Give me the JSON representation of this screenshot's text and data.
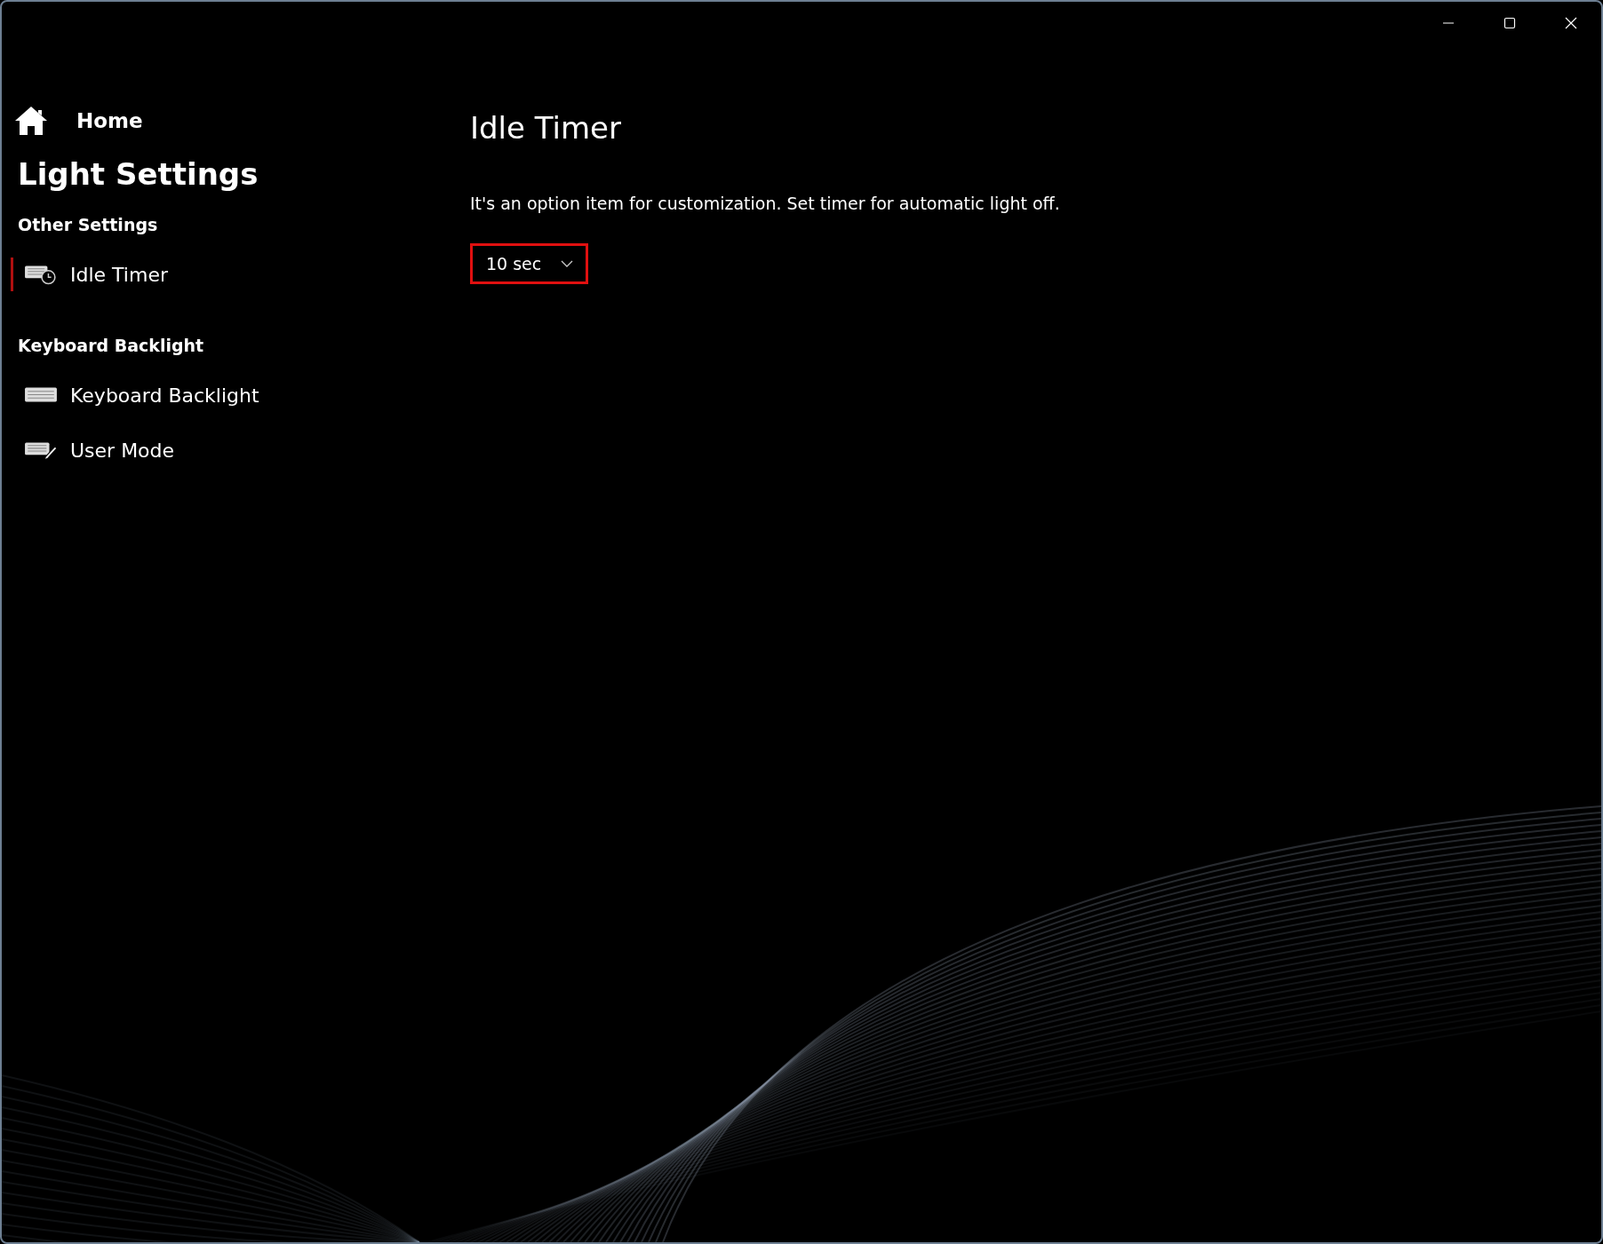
{
  "sidebar": {
    "home": "Home",
    "title": "Light Settings",
    "sections": [
      {
        "heading": "Other Settings",
        "items": [
          {
            "label": "Idle Timer",
            "selected": true
          }
        ]
      },
      {
        "heading": "Keyboard Backlight",
        "items": [
          {
            "label": "Keyboard Backlight",
            "selected": false
          },
          {
            "label": "User Mode",
            "selected": false
          }
        ]
      }
    ]
  },
  "content": {
    "title": "Idle Timer",
    "description": "It's an option item for customization. Set timer for automatic light off.",
    "dropdown": {
      "value": "10 sec",
      "focused": true
    }
  }
}
